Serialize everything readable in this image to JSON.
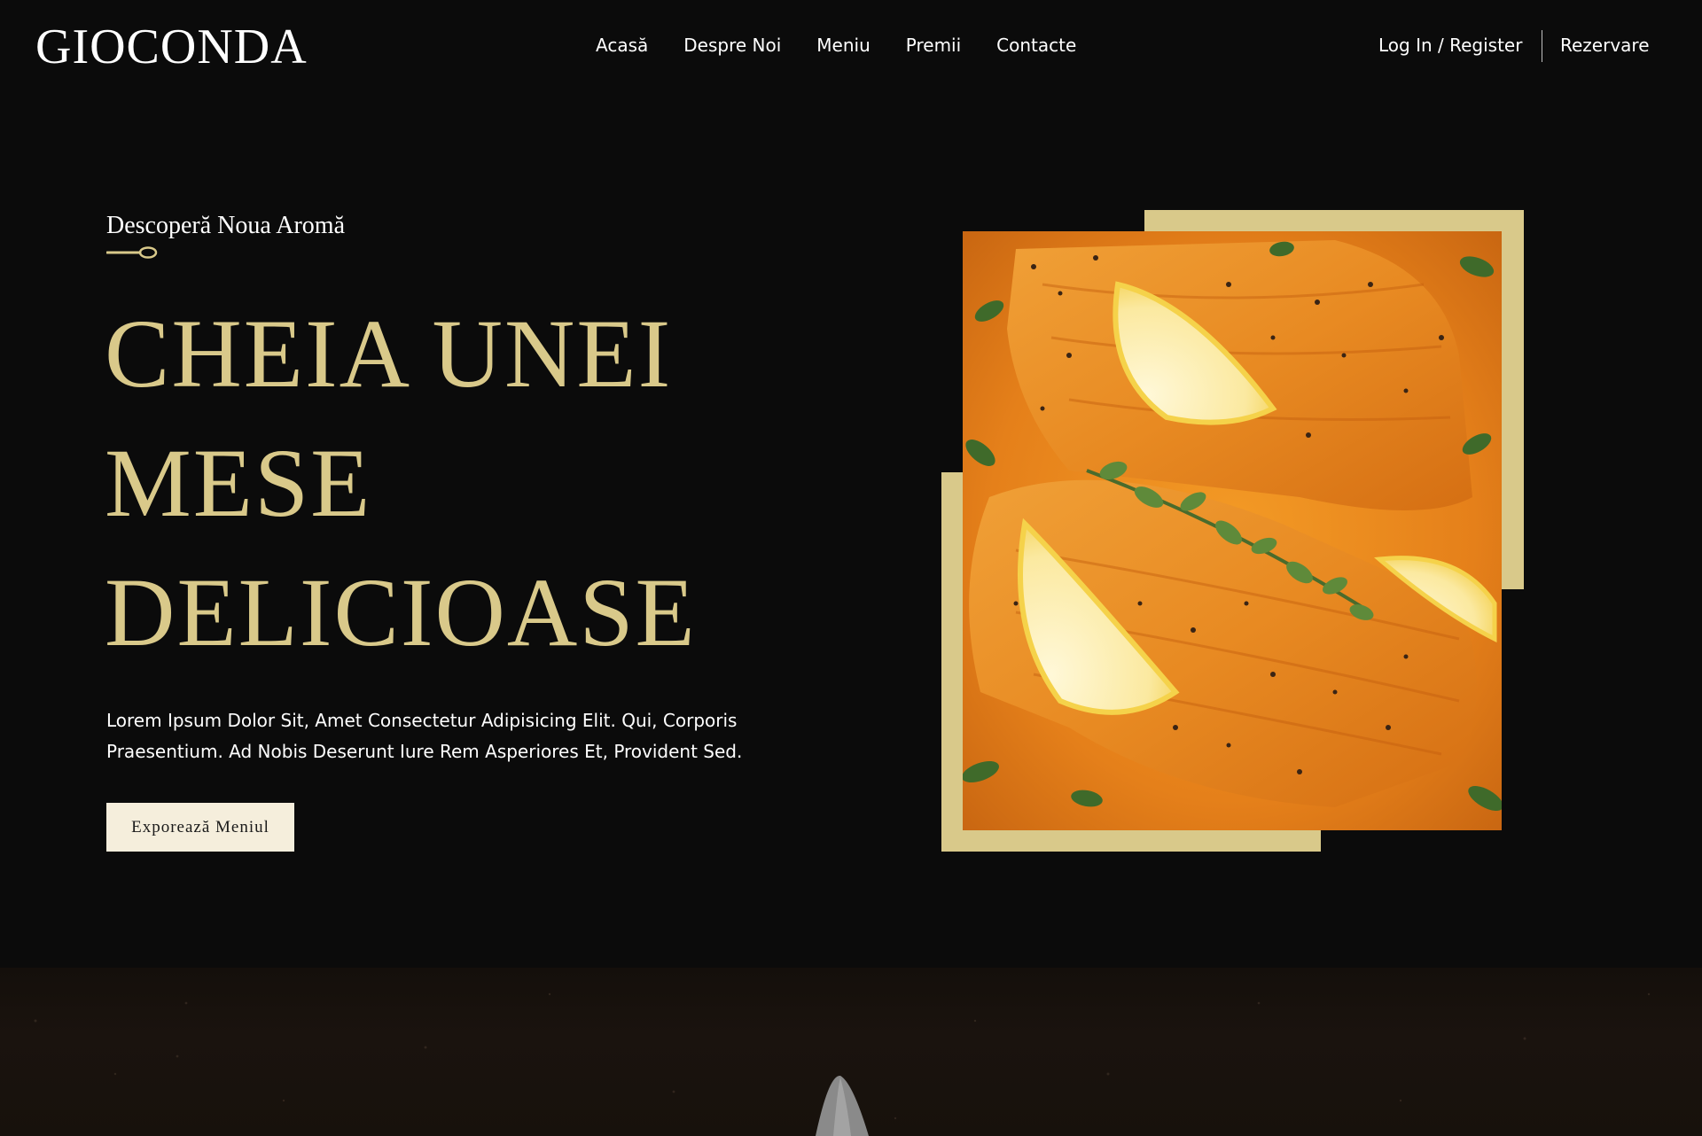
{
  "brand": {
    "logo": "GIOCONDA",
    "accent_color": "#d9c98a",
    "background_color": "#0b0b0b"
  },
  "nav": {
    "items": [
      {
        "label": "Acasă"
      },
      {
        "label": "Despre Noi"
      },
      {
        "label": "Meniu"
      },
      {
        "label": "Premii"
      },
      {
        "label": "Contacte"
      }
    ],
    "auth_label": "Log In / Register",
    "reserve_label": "Rezervare"
  },
  "hero": {
    "subtitle": "Descoperă Noua Aromă",
    "subtitle_icon": "spoon-icon",
    "title_lines": [
      "CHEIA UNEI",
      "MESE",
      "DELICIOASE"
    ],
    "description": "Lorem Ipsum Dolor Sit, Amet Consectetur Adipisicing Elit. Qui, Corporis Praesentium. Ad Nobis Deserunt Iure Rem Asperiores Et, Provident Sed.",
    "cta_label": "Exporează Meniul",
    "cta_background": "#f5eedc"
  }
}
